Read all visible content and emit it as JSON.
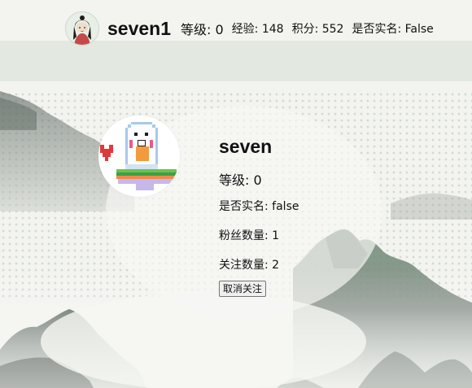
{
  "header": {
    "username": "seven1",
    "level_text": "等级: 0",
    "exp_text": "经验: 148",
    "points_text": "积分: 552",
    "realname_text": "是否实名: False"
  },
  "profile": {
    "name": "seven",
    "level_text": "等级: 0",
    "realname_text": "是否实名: false",
    "fans_text": "粉丝数量: 1",
    "follow_text": "关注数量: 2",
    "unfollow_label": "取消关注"
  },
  "colors": {
    "background": "#f2f3ef",
    "mountain": "#3f4a45",
    "accent_green": "#7fa87a"
  },
  "icons": {
    "top_avatar": "user-avatar-icon",
    "profile_avatar": "pixel-ghost-avatar-icon"
  }
}
